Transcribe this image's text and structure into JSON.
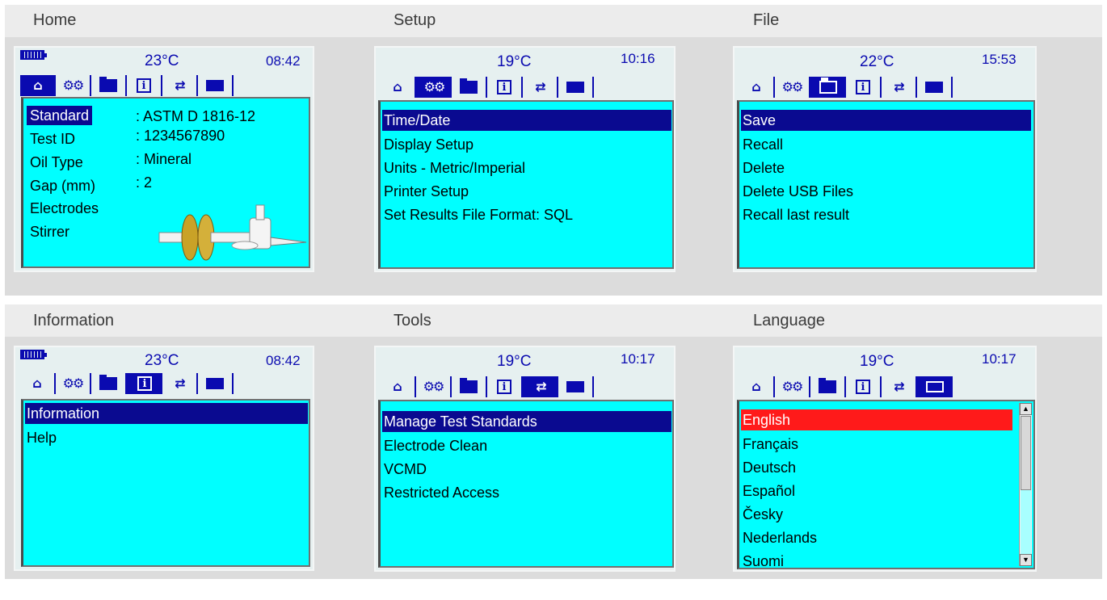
{
  "sections": {
    "home": "Home",
    "setup": "Setup",
    "file": "File",
    "information": "Information",
    "tools": "Tools",
    "language": "Language"
  },
  "icons": [
    "home-icon",
    "gears-icon",
    "folder-icon",
    "info-icon",
    "tools-icon",
    "flag-icon"
  ],
  "colors": {
    "screen_bg": "#00ffff",
    "selection": "#0a0a90",
    "accent": "#0a0ab0",
    "language_highlight": "#ff1a1a"
  },
  "home": {
    "temp": "23°C",
    "time": "08:42",
    "rows": [
      {
        "key": "Standard",
        "value": ": ASTM D 1816-12"
      },
      {
        "key": "Test ID",
        "value": ": 1234567890"
      },
      {
        "key": "Oil Type",
        "value": ": Mineral"
      },
      {
        "key": "Gap (mm)",
        "value": ": 2"
      },
      {
        "key": "Electrodes",
        "value": ""
      },
      {
        "key": "Stirrer",
        "value": ""
      }
    ]
  },
  "setup": {
    "temp": "19°C",
    "time": "10:16",
    "items": [
      "Time/Date",
      "Display Setup",
      "Units - Metric/Imperial",
      "Printer Setup",
      "Set Results File Format: SQL"
    ]
  },
  "file": {
    "temp": "22°C",
    "time": "15:53",
    "items": [
      "Save",
      "Recall",
      "Delete",
      "Delete USB Files",
      "Recall last result"
    ]
  },
  "information": {
    "temp": "23°C",
    "time": "08:42",
    "items": [
      "Information",
      "Help"
    ]
  },
  "tools": {
    "temp": "19°C",
    "time": "10:17",
    "items": [
      "Manage Test Standards",
      "Electrode Clean",
      "VCMD",
      "Restricted Access"
    ]
  },
  "language": {
    "temp": "19°C",
    "time": "10:17",
    "items": [
      "English",
      "Français",
      "Deutsch",
      "Español",
      "Česky",
      "Nederlands",
      "Suomi"
    ]
  }
}
